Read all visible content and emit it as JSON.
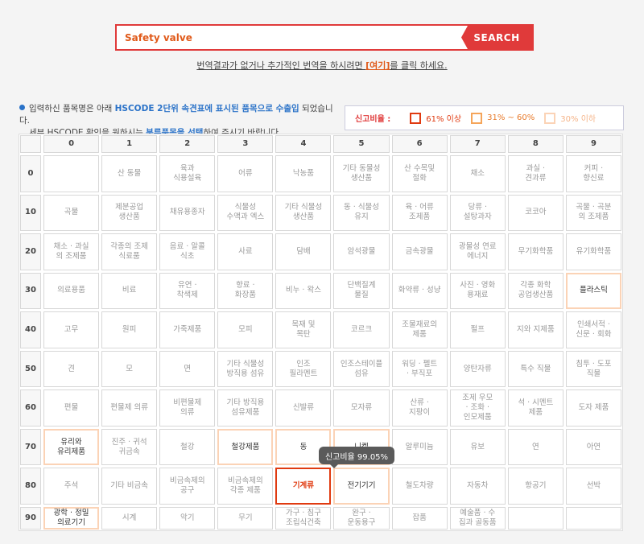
{
  "search": {
    "value": "Safety valve",
    "button": "SEARCH"
  },
  "subnote": {
    "pre": "번역결과가 없거나 추가적인 번역을 하시려면 ",
    "link": "[여기]",
    "post": "를 클릭 하세요."
  },
  "info": {
    "l1_a": "입력하신 품목명은 아래 ",
    "l1_b": "HSCODE 2단위 속견표에 표시된 품목으로 수출입",
    "l1_c": " 되었습니다.",
    "l2_a": "세부 HSCODE 확인을 원하시는 ",
    "l2_b": "분류품목을 선택",
    "l2_c": "하여 주시기 바랍니다."
  },
  "legend": {
    "title": "신고비율 :",
    "items": [
      {
        "label": "61% 이상",
        "color": "#e03a10",
        "text_color": "#e03a10"
      },
      {
        "label": "31% ~ 60%",
        "color": "#f5a55a",
        "text_color": "#e87a2a"
      },
      {
        "label": "30% 이하",
        "color": "#fbd3b6",
        "text_color": "#f5b58a"
      }
    ]
  },
  "columns": [
    "0",
    "1",
    "2",
    "3",
    "4",
    "5",
    "6",
    "7",
    "8",
    "9"
  ],
  "rows": [
    {
      "label": "0",
      "cells": [
        {
          "t": ""
        },
        {
          "t": "산 동물"
        },
        {
          "t": "육과\n식용설육"
        },
        {
          "t": "어류"
        },
        {
          "t": "낙농품"
        },
        {
          "t": "기타 동물성\n생산품"
        },
        {
          "t": "산 수목및\n절화"
        },
        {
          "t": "채소"
        },
        {
          "t": "과실 ·\n견과류"
        },
        {
          "t": "커피 ·\n향신료"
        }
      ]
    },
    {
      "label": "10",
      "cells": [
        {
          "t": "곡물"
        },
        {
          "t": "제분공업\n생산품"
        },
        {
          "t": "채유용종자"
        },
        {
          "t": "식물성\n수액과 엑스"
        },
        {
          "t": "기타 식물성\n생산품"
        },
        {
          "t": "동 · 식물성\n유지"
        },
        {
          "t": "육 · 어류\n조제품"
        },
        {
          "t": "당류 ·\n설탕과자"
        },
        {
          "t": "코코아"
        },
        {
          "t": "곡물 · 곡분\n의 조제품"
        }
      ]
    },
    {
      "label": "20",
      "cells": [
        {
          "t": "채소 · 과실\n의 조제품"
        },
        {
          "t": "각종의 조제\n식료품"
        },
        {
          "t": "음료 · 알콜\n식초"
        },
        {
          "t": "사료"
        },
        {
          "t": "담배"
        },
        {
          "t": "암석광물"
        },
        {
          "t": "금속광물"
        },
        {
          "t": "광물성 연료\n에너지"
        },
        {
          "t": "무기화학품"
        },
        {
          "t": "유기화학품"
        }
      ]
    },
    {
      "label": "30",
      "cells": [
        {
          "t": "의료용품"
        },
        {
          "t": "비료"
        },
        {
          "t": "유연 ·\n착색제"
        },
        {
          "t": "향료 ·\n화장품"
        },
        {
          "t": "비누 · 왁스"
        },
        {
          "t": "단백질계\n물질"
        },
        {
          "t": "화약류 · 성냥"
        },
        {
          "t": "사진 · 영화\n용재료"
        },
        {
          "t": "각종 화학\n공업생산품"
        },
        {
          "t": "플라스틱",
          "l": "low"
        }
      ]
    },
    {
      "label": "40",
      "cells": [
        {
          "t": "고무"
        },
        {
          "t": "원피"
        },
        {
          "t": "가죽제품"
        },
        {
          "t": "모피"
        },
        {
          "t": "목재 및\n목탄"
        },
        {
          "t": "코르크"
        },
        {
          "t": "조물재료의\n제품"
        },
        {
          "t": "펄프"
        },
        {
          "t": "지와 지제품"
        },
        {
          "t": "인쇄서적 ·\n신문 · 회화"
        }
      ]
    },
    {
      "label": "50",
      "cells": [
        {
          "t": "견"
        },
        {
          "t": "모"
        },
        {
          "t": "면"
        },
        {
          "t": "기타 식물성\n방직용 섬유"
        },
        {
          "t": "인조\n필라멘트"
        },
        {
          "t": "인조스테이플\n섬유"
        },
        {
          "t": "워딩 · 펠트\n· 부직포"
        },
        {
          "t": "양탄자류"
        },
        {
          "t": "특수 직물"
        },
        {
          "t": "침투 · 도포\n직물"
        }
      ]
    },
    {
      "label": "60",
      "cells": [
        {
          "t": "편물"
        },
        {
          "t": "편물제 의류"
        },
        {
          "t": "비편물제\n의류"
        },
        {
          "t": "기타 방직용\n섬유제품"
        },
        {
          "t": "신발류"
        },
        {
          "t": "모자류"
        },
        {
          "t": "산류 ·\n지팡이"
        },
        {
          "t": "조제 우모\n· 조화 ·\n인모제품"
        },
        {
          "t": "석 · 시멘트\n제품"
        },
        {
          "t": "도자 제품"
        }
      ]
    },
    {
      "label": "70",
      "cells": [
        {
          "t": "유리와\n유리제품",
          "l": "low"
        },
        {
          "t": "진주 · 귀석\n귀금속"
        },
        {
          "t": "철강"
        },
        {
          "t": "철강제품",
          "l": "low"
        },
        {
          "t": "동",
          "l": "low"
        },
        {
          "t": "니켈",
          "l": "low"
        },
        {
          "t": "알루미늄"
        },
        {
          "t": "유보"
        },
        {
          "t": "연"
        },
        {
          "t": "아연"
        }
      ]
    },
    {
      "label": "80",
      "cells": [
        {
          "t": "주석"
        },
        {
          "t": "기타 비금속"
        },
        {
          "t": "비금속제의\n공구"
        },
        {
          "t": "비금속제의\n각종 제품"
        },
        {
          "t": "기계류",
          "l": "hi"
        },
        {
          "t": "전기기기",
          "l": "low"
        },
        {
          "t": "철도차량"
        },
        {
          "t": "자동차"
        },
        {
          "t": "항공기"
        },
        {
          "t": "선박"
        }
      ]
    },
    {
      "label": "90",
      "cells": [
        {
          "t": "광학 · 정밀\n의료기기",
          "l": "low"
        },
        {
          "t": "시계"
        },
        {
          "t": "악기"
        },
        {
          "t": "무기"
        },
        {
          "t": "가구 · 침구\n조립식건축"
        },
        {
          "t": "완구 ·\n운동용구"
        },
        {
          "t": "잡품"
        },
        {
          "t": "예술품 · 수\n집과 골동품"
        },
        {
          "t": ""
        },
        {
          "t": ""
        }
      ]
    }
  ],
  "tooltip": "신고비율 99.05%"
}
